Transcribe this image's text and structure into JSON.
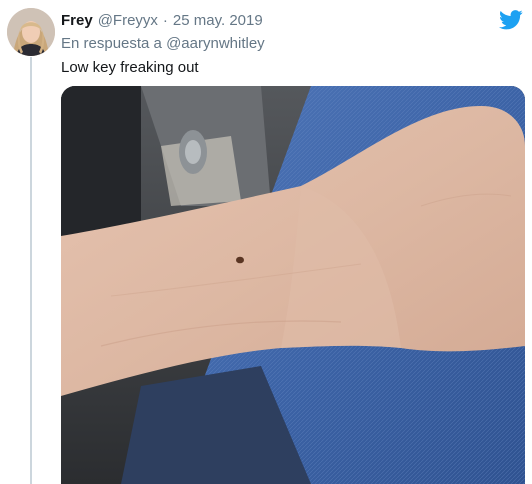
{
  "tweet": {
    "display_name": "Frey",
    "handle": "@Freyyx",
    "separator": "·",
    "date": "25 may. 2019",
    "reply_prefix": "En respuesta a",
    "reply_mention": "@aarynwhitley",
    "text": "Low key freaking out",
    "avatar_icon": "user-avatar",
    "logo_icon": "twitter-bird-icon",
    "media_icon": "photo-wrist-mole"
  },
  "colors": {
    "brand": "#1da1f2",
    "name": "#14171a",
    "secondary": "#657786",
    "thread_line": "#ccd6dd"
  }
}
